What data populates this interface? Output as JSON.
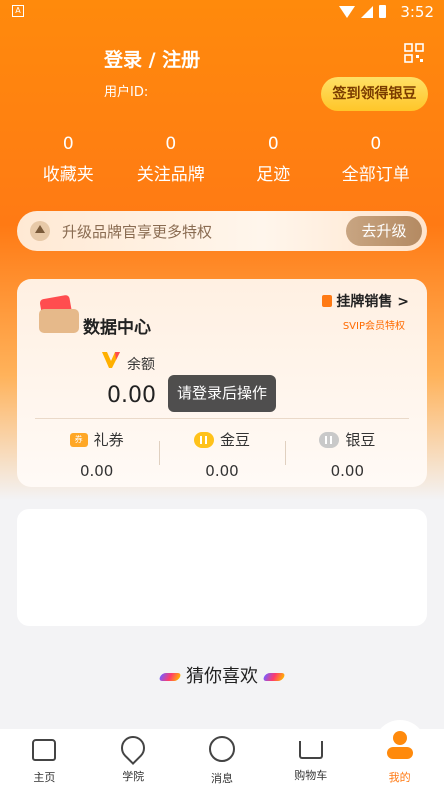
{
  "status_bar": {
    "time": "3:52",
    "app_badge": "A"
  },
  "profile": {
    "title": "登录 / 注册",
    "user_id_label": "用户ID:",
    "signin_button": "签到领得银豆"
  },
  "stats": [
    {
      "value": "0",
      "label": "收藏夹"
    },
    {
      "value": "0",
      "label": "关注品牌"
    },
    {
      "value": "0",
      "label": "足迹"
    },
    {
      "value": "0",
      "label": "全部订单"
    }
  ],
  "upgrade": {
    "text": "升级品牌官享更多特权",
    "button": "去升级"
  },
  "data_center": {
    "title": "数据中心",
    "sell_link": "挂牌销售 >",
    "svip_note": "SVIP会员特权",
    "balance_label": "余额",
    "balance_value": "0.00",
    "assets": [
      {
        "label": "礼券",
        "value": "0.00",
        "icon": "coupon-icon",
        "badge": "券"
      },
      {
        "label": "金豆",
        "value": "0.00",
        "icon": "gold-bean-icon"
      },
      {
        "label": "银豆",
        "value": "0.00",
        "icon": "silver-bean-icon"
      }
    ]
  },
  "toast": "请登录后操作",
  "recommend": {
    "title": "猜你喜欢"
  },
  "tabbar": [
    {
      "label": "主页",
      "icon": "home-icon"
    },
    {
      "label": "学院",
      "icon": "academy-icon"
    },
    {
      "label": "消息",
      "icon": "message-icon"
    },
    {
      "label": "购物车",
      "icon": "cart-icon"
    },
    {
      "label": "我的",
      "icon": "profile-icon",
      "active": true
    }
  ],
  "colors": {
    "accent": "#ff7a14",
    "gold": "#ffc629",
    "toast_bg": "#3c3c3c"
  }
}
